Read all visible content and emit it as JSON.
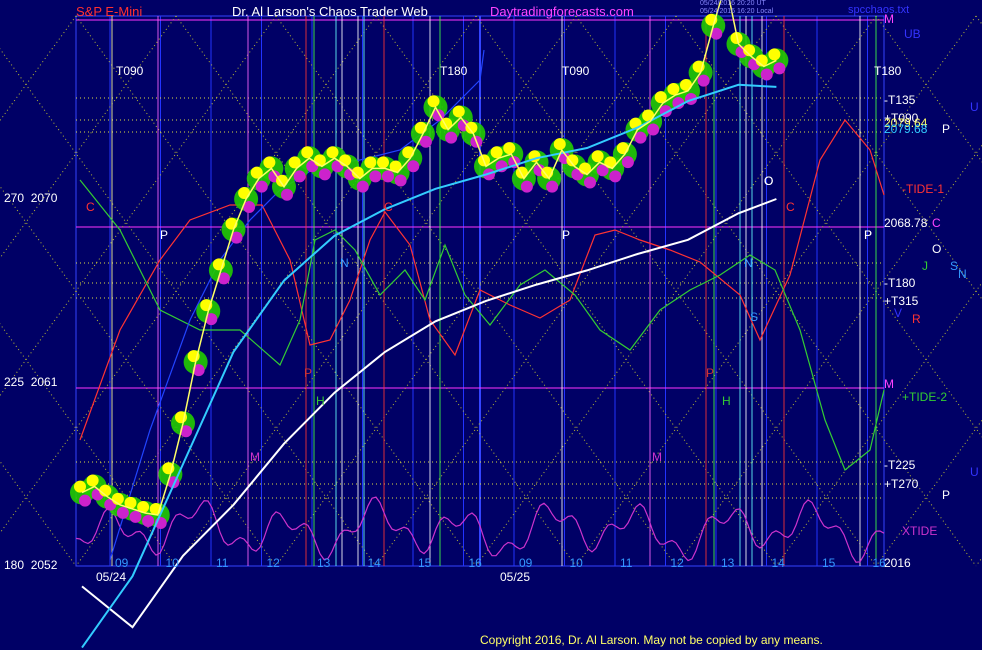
{
  "header": {
    "title": "S&P E-Mini",
    "brand": "Dr. Al Larson's Chaos Trader Web",
    "site": "Daytradingforecasts.com",
    "stamp1": "05/24/2016 20:20 UT",
    "stamp2": "05/24/2016 16:20 Local",
    "file": "spcchaos.txt"
  },
  "copyright": "Copyright 2016, Dr. Al Larson. May not be copied by any means.",
  "colors": {
    "background": "#000066",
    "grid_blue": "#2233ff",
    "price_up": "#ffff66",
    "white_line": "#ffffff",
    "cyan_line": "#33ccff",
    "green_line": "#33cc33",
    "red_line": "#ff3333",
    "xtide": "#cc33cc",
    "blob_green": "#22cc00",
    "blob_yellow": "#ffff00",
    "blob_magenta": "#cc22cc"
  },
  "y_labels": [
    {
      "deg": "270",
      "price": "2070"
    },
    {
      "deg": "225",
      "price": "2061"
    },
    {
      "deg": "180",
      "price": "2052"
    }
  ],
  "x_labels": [
    "09",
    "10",
    "11",
    "12",
    "13",
    "14",
    "15",
    "16",
    "09",
    "10",
    "11",
    "12",
    "13",
    "14",
    "15",
    "16"
  ],
  "date_labels": [
    "05/24",
    "05/25"
  ],
  "right_labels": [
    {
      "text": "M",
      "color": "#ff44ff"
    },
    {
      "text": "UB",
      "color": "#3333ff"
    },
    {
      "text": "T180",
      "color": "#ffffff"
    },
    {
      "text": "-T135",
      "color": "#ffffff"
    },
    {
      "text": "U",
      "color": "#3333ff"
    },
    {
      "text": "+T090",
      "color": "#ffffff"
    },
    {
      "text": "2079.64",
      "color": "#ffff66"
    },
    {
      "text": "2079.68",
      "color": "#33ccff"
    },
    {
      "text": "P",
      "color": "#ffffff"
    },
    {
      "text": "O",
      "color": "#ffffff"
    },
    {
      "text": "-TIDE-1",
      "color": "#ff3333"
    },
    {
      "text": "2068.78",
      "color": "#ffffff"
    },
    {
      "text": "C",
      "color": "#ff44ff"
    },
    {
      "text": "P",
      "color": "#ffffff"
    },
    {
      "text": "O",
      "color": "#ffffff"
    },
    {
      "text": "J",
      "color": "#33cc33"
    },
    {
      "text": "S",
      "color": "#3399ff"
    },
    {
      "text": "N",
      "color": "#3399ff"
    },
    {
      "text": "-T180",
      "color": "#ffffff"
    },
    {
      "text": "+T315",
      "color": "#ffffff"
    },
    {
      "text": "V",
      "color": "#3333ff"
    },
    {
      "text": "R",
      "color": "#ff3333"
    },
    {
      "text": "M",
      "color": "#ff44ff"
    },
    {
      "text": "+TIDE-2",
      "color": "#33cc33"
    },
    {
      "text": "-T225",
      "color": "#ffffff"
    },
    {
      "text": "U",
      "color": "#3333ff"
    },
    {
      "text": "+T270",
      "color": "#ffffff"
    },
    {
      "text": "P",
      "color": "#ffffff"
    },
    {
      "text": "XTIDE",
      "color": "#cc33cc"
    },
    {
      "text": "2016",
      "color": "#ffffff"
    }
  ],
  "chart_labels": [
    {
      "text": "T090",
      "color": "#ffffff"
    },
    {
      "text": "T180",
      "color": "#ffffff"
    },
    {
      "text": "T090",
      "color": "#ffffff"
    },
    {
      "text": "P",
      "color": "#ffffff"
    },
    {
      "text": "P",
      "color": "#ffffff"
    },
    {
      "text": "P",
      "color": "#ffffff"
    },
    {
      "text": "C",
      "color": "#ff3333"
    },
    {
      "text": "C",
      "color": "#ff3333"
    },
    {
      "text": "C",
      "color": "#ff3333"
    },
    {
      "text": "N",
      "color": "#3399ff"
    },
    {
      "text": "N",
      "color": "#3399ff"
    },
    {
      "text": "M",
      "color": "#cc33cc"
    },
    {
      "text": "M",
      "color": "#cc33cc"
    },
    {
      "text": "H",
      "color": "#33cc33"
    },
    {
      "text": "H",
      "color": "#33cc33"
    },
    {
      "text": "P",
      "color": "#cc3333"
    },
    {
      "text": "P",
      "color": "#cc3333"
    },
    {
      "text": "O",
      "color": "#ffffff"
    },
    {
      "text": "S",
      "color": "#3399ff"
    }
  ],
  "chart_data": {
    "type": "line",
    "title": "S&P E-Mini",
    "ylim": [
      2052,
      2083
    ],
    "x_sessions": [
      "05/24",
      "05/25"
    ],
    "series": [
      {
        "name": "price",
        "x": [
          0,
          0.5,
          1,
          1.5,
          2,
          2.5,
          3,
          3.5,
          4,
          4.5,
          5,
          5.5,
          6,
          6.5,
          7,
          7.5,
          8,
          8.5,
          9,
          9.5,
          10,
          10.5,
          11,
          11.5,
          12,
          12.5,
          13,
          13.5,
          14,
          14.5,
          15,
          15.5,
          16,
          16.5,
          17,
          17.5,
          18,
          18.5,
          19,
          19.5,
          20,
          20.5,
          21,
          21.5,
          22,
          22.5,
          23,
          23.5,
          24,
          24.5,
          25,
          25.5,
          26,
          26.5,
          27,
          27.5
        ],
        "values": [
          2055.6,
          2055.9,
          2055.4,
          2055.0,
          2054.8,
          2054.6,
          2054.5,
          2056.5,
          2059.0,
          2062.0,
          2064.5,
          2066.5,
          2068.5,
          2070.0,
          2071.0,
          2071.5,
          2070.6,
          2071.5,
          2072.0,
          2071.6,
          2072.0,
          2071.6,
          2071.0,
          2071.5,
          2071.5,
          2071.3,
          2072.0,
          2073.2,
          2074.5,
          2073.4,
          2074.0,
          2073.2,
          2071.6,
          2072.0,
          2072.2,
          2071.0,
          2071.8,
          2071.0,
          2072.4,
          2071.6,
          2071.2,
          2071.8,
          2071.5,
          2072.2,
          2073.4,
          2073.8,
          2074.7,
          2075.1,
          2075.3,
          2076.2,
          2078.5,
          2080.6,
          2077.6,
          2077.0,
          2076.5,
          2076.8
        ]
      },
      {
        "name": "white",
        "x": [
          0,
          2,
          4,
          6,
          8,
          10,
          12,
          14,
          16,
          18,
          20,
          22,
          24,
          26,
          27.5
        ],
        "values": [
          2051.0,
          2049.0,
          2052.5,
          2055.0,
          2058.0,
          2060.5,
          2062.5,
          2064.0,
          2065.0,
          2065.8,
          2066.5,
          2067.3,
          2068.0,
          2069.3,
          2070.0
        ]
      },
      {
        "name": "cyan",
        "x": [
          0,
          2,
          4,
          6,
          8,
          10,
          12,
          14,
          16,
          18,
          20,
          22,
          24,
          26,
          27.5
        ],
        "values": [
          2048.0,
          2051.5,
          2057.0,
          2062.5,
          2066.0,
          2068.2,
          2069.5,
          2070.5,
          2071.2,
          2072.0,
          2072.5,
          2073.5,
          2074.8,
          2075.6,
          2075.5
        ]
      }
    ]
  }
}
